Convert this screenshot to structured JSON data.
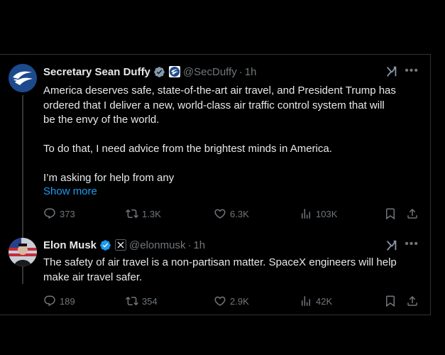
{
  "tweets": [
    {
      "name": "Secretary Sean Duffy",
      "handle": "@SecDuffy",
      "separator": "·",
      "time": "1h",
      "avatar": "dot-eagle-logo",
      "verified_color": "#829aab",
      "body_lines": [
        "America deserves safe, state-of-the-art air travel, and President Trump has",
        "ordered that I deliver a new, world-class air traffic control system that will",
        "be the envy of the world.",
        "",
        "To do that, I need advice from the brightest minds in America.",
        "",
        "I’m asking for help from any"
      ],
      "show_more": "Show more",
      "stats": {
        "replies": "373",
        "reposts": "1.3K",
        "likes": "6.3K",
        "views": "103K"
      }
    },
    {
      "name": "Elon Musk",
      "handle": "@elonmusk",
      "separator": "·",
      "time": "1h",
      "avatar": "elon-musk-photo",
      "verified_color": "#1d9bf0",
      "body_lines": [
        "The safety of air travel is a non-partisan matter. SpaceX engineers will help",
        "make air travel safer."
      ],
      "stats": {
        "replies": "189",
        "reposts": "354",
        "likes": "2.9K",
        "views": "42K"
      }
    }
  ],
  "colors": {
    "accent": "#1d9bf0",
    "muted": "#71767b",
    "border": "#2f3336",
    "text": "#e7e9ea"
  }
}
